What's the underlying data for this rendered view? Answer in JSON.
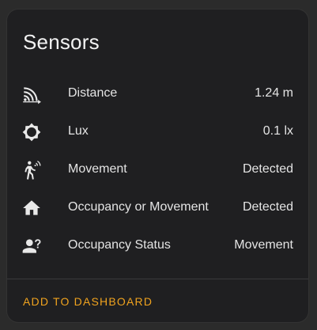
{
  "card": {
    "title": "Sensors",
    "action_label": "ADD TO DASHBOARD",
    "accent_color": "#f0a31e"
  },
  "sensors": [
    {
      "icon": "signal-distance-icon",
      "label": "Distance",
      "value": "1.24 m"
    },
    {
      "icon": "brightness-icon",
      "label": "Lux",
      "value": "0.1 lx"
    },
    {
      "icon": "motion-sensor-icon",
      "label": "Movement",
      "value": "Detected"
    },
    {
      "icon": "home-icon",
      "label": "Occupancy or Movement",
      "value": "Detected"
    },
    {
      "icon": "account-question-icon",
      "label": "Occupancy Status",
      "value": "Movement"
    }
  ]
}
